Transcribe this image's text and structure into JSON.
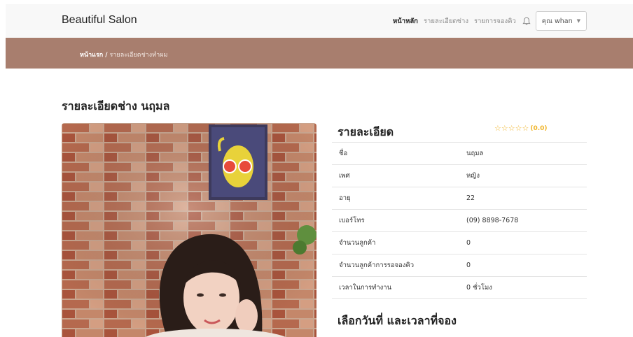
{
  "navbar": {
    "brand": "Beautiful Salon",
    "links": [
      {
        "label": "หน้าหลัก",
        "active": true
      },
      {
        "label": "รายละเอียดช่าง",
        "active": false
      },
      {
        "label": "รายการจองคิว",
        "active": false
      }
    ],
    "bell_icon": "bell-icon",
    "user_label": "คุณ whan"
  },
  "breadcrumb": {
    "home": "หน้าแรก",
    "separator": "/",
    "current": "รายละเอียดช่างทำผม"
  },
  "page": {
    "title": "รายละเอียดช่าง นฤมล"
  },
  "details": {
    "title": "รายละเอียด",
    "rating_stars": 0,
    "rating_max": 5,
    "rating_text": "(0.0)",
    "rows": [
      {
        "label": "ชื่อ",
        "value": "นฤมล"
      },
      {
        "label": "เพศ",
        "value": "หญิง"
      },
      {
        "label": "อายุ",
        "value": "22"
      },
      {
        "label": "เบอร์โทร",
        "value": "(09) 8898-7678"
      },
      {
        "label": "จำนวนลูกค้า",
        "value": "0"
      },
      {
        "label": "จำนวนลูกค้าการรอจองคิว",
        "value": "0"
      },
      {
        "label": "เวลาในการทำงาน",
        "value": "0 ชั่วโมง"
      }
    ]
  },
  "booking": {
    "title": "เลือกวันที่ และเวลาที่จอง"
  },
  "colors": {
    "navbar_bg": "#f8f8f8",
    "breadcrumb_bg": "#a87e6e",
    "star": "#f0b429"
  }
}
